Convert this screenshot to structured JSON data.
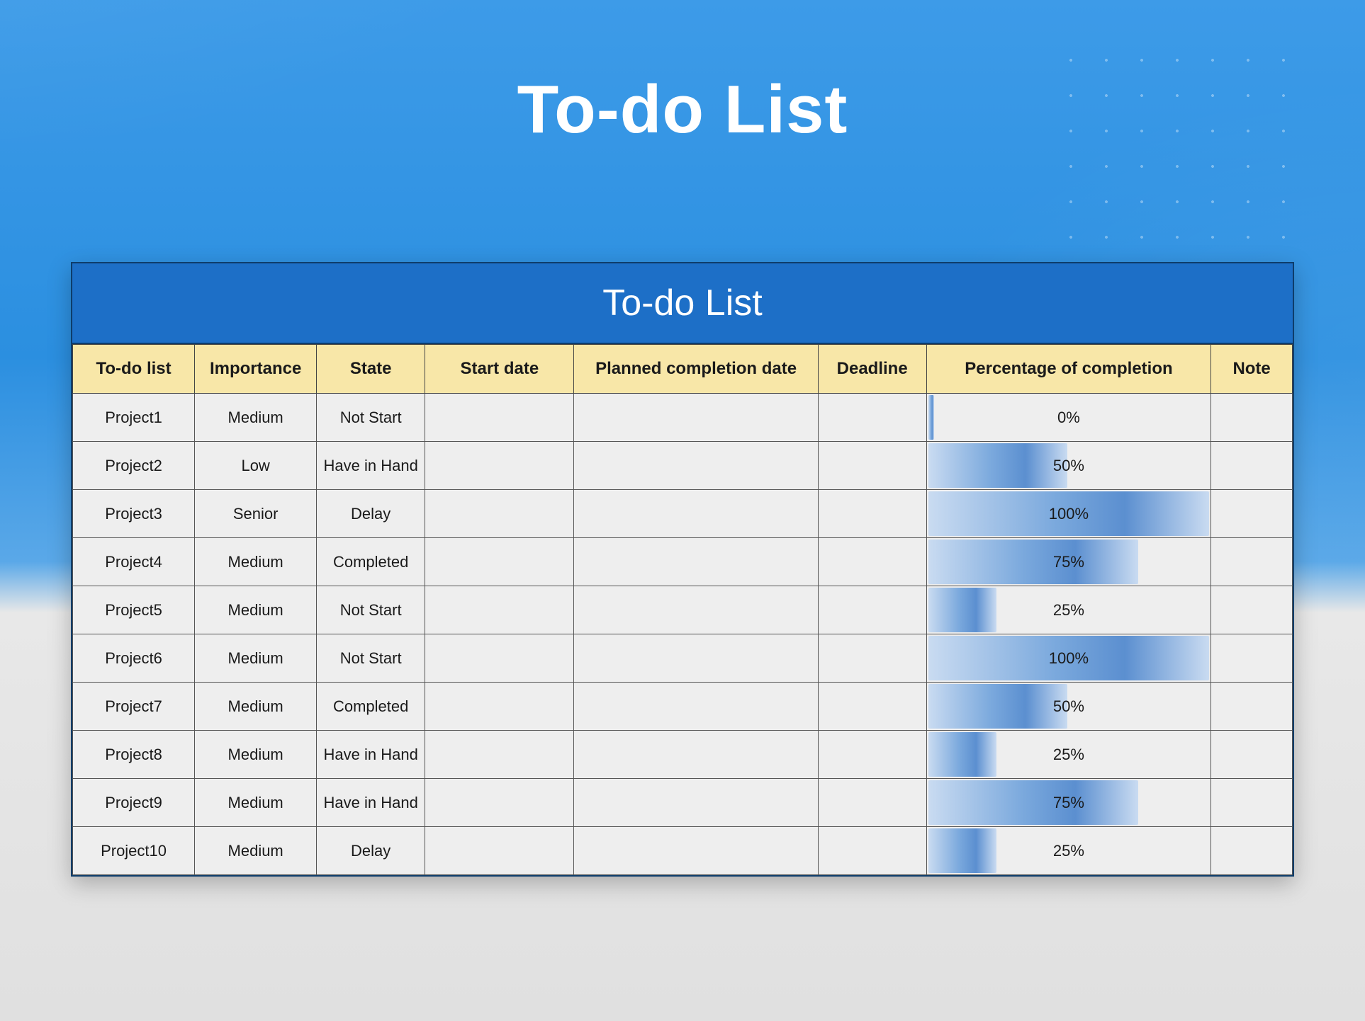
{
  "page": {
    "title": "To-do List"
  },
  "table": {
    "title": "To-do List",
    "headers": {
      "todo": "To-do list",
      "importance": "Importance",
      "state": "State",
      "start": "Start date",
      "planned": "Planned completion date",
      "deadline": "Deadline",
      "percent": "Percentage of completion",
      "note": "Note"
    },
    "rows": [
      {
        "todo": "Project1",
        "importance": "Medium",
        "state": "Not Start",
        "start": "",
        "planned": "",
        "deadline": "",
        "percent": 0,
        "percent_label": "0%",
        "note": ""
      },
      {
        "todo": "Project2",
        "importance": "Low",
        "state": "Have in Hand",
        "start": "",
        "planned": "",
        "deadline": "",
        "percent": 50,
        "percent_label": "50%",
        "note": ""
      },
      {
        "todo": "Project3",
        "importance": "Senior",
        "state": "Delay",
        "start": "",
        "planned": "",
        "deadline": "",
        "percent": 100,
        "percent_label": "100%",
        "note": ""
      },
      {
        "todo": "Project4",
        "importance": "Medium",
        "state": "Completed",
        "start": "",
        "planned": "",
        "deadline": "",
        "percent": 75,
        "percent_label": "75%",
        "note": ""
      },
      {
        "todo": "Project5",
        "importance": "Medium",
        "state": "Not Start",
        "start": "",
        "planned": "",
        "deadline": "",
        "percent": 25,
        "percent_label": "25%",
        "note": ""
      },
      {
        "todo": "Project6",
        "importance": "Medium",
        "state": "Not Start",
        "start": "",
        "planned": "",
        "deadline": "",
        "percent": 100,
        "percent_label": "100%",
        "note": ""
      },
      {
        "todo": "Project7",
        "importance": "Medium",
        "state": "Completed",
        "start": "",
        "planned": "",
        "deadline": "",
        "percent": 50,
        "percent_label": "50%",
        "note": ""
      },
      {
        "todo": "Project8",
        "importance": "Medium",
        "state": "Have in Hand",
        "start": "",
        "planned": "",
        "deadline": "",
        "percent": 25,
        "percent_label": "25%",
        "note": ""
      },
      {
        "todo": "Project9",
        "importance": "Medium",
        "state": "Have in Hand",
        "start": "",
        "planned": "",
        "deadline": "",
        "percent": 75,
        "percent_label": "75%",
        "note": ""
      },
      {
        "todo": "Project10",
        "importance": "Medium",
        "state": "Delay",
        "start": "",
        "planned": "",
        "deadline": "",
        "percent": 25,
        "percent_label": "25%",
        "note": ""
      }
    ]
  },
  "chart_data": {
    "type": "bar",
    "title": "Percentage of completion",
    "categories": [
      "Project1",
      "Project2",
      "Project3",
      "Project4",
      "Project5",
      "Project6",
      "Project7",
      "Project8",
      "Project9",
      "Project10"
    ],
    "values": [
      0,
      50,
      100,
      75,
      25,
      100,
      50,
      25,
      75,
      25
    ],
    "xlabel": "To-do list",
    "ylabel": "Percentage of completion",
    "ylim": [
      0,
      100
    ]
  }
}
